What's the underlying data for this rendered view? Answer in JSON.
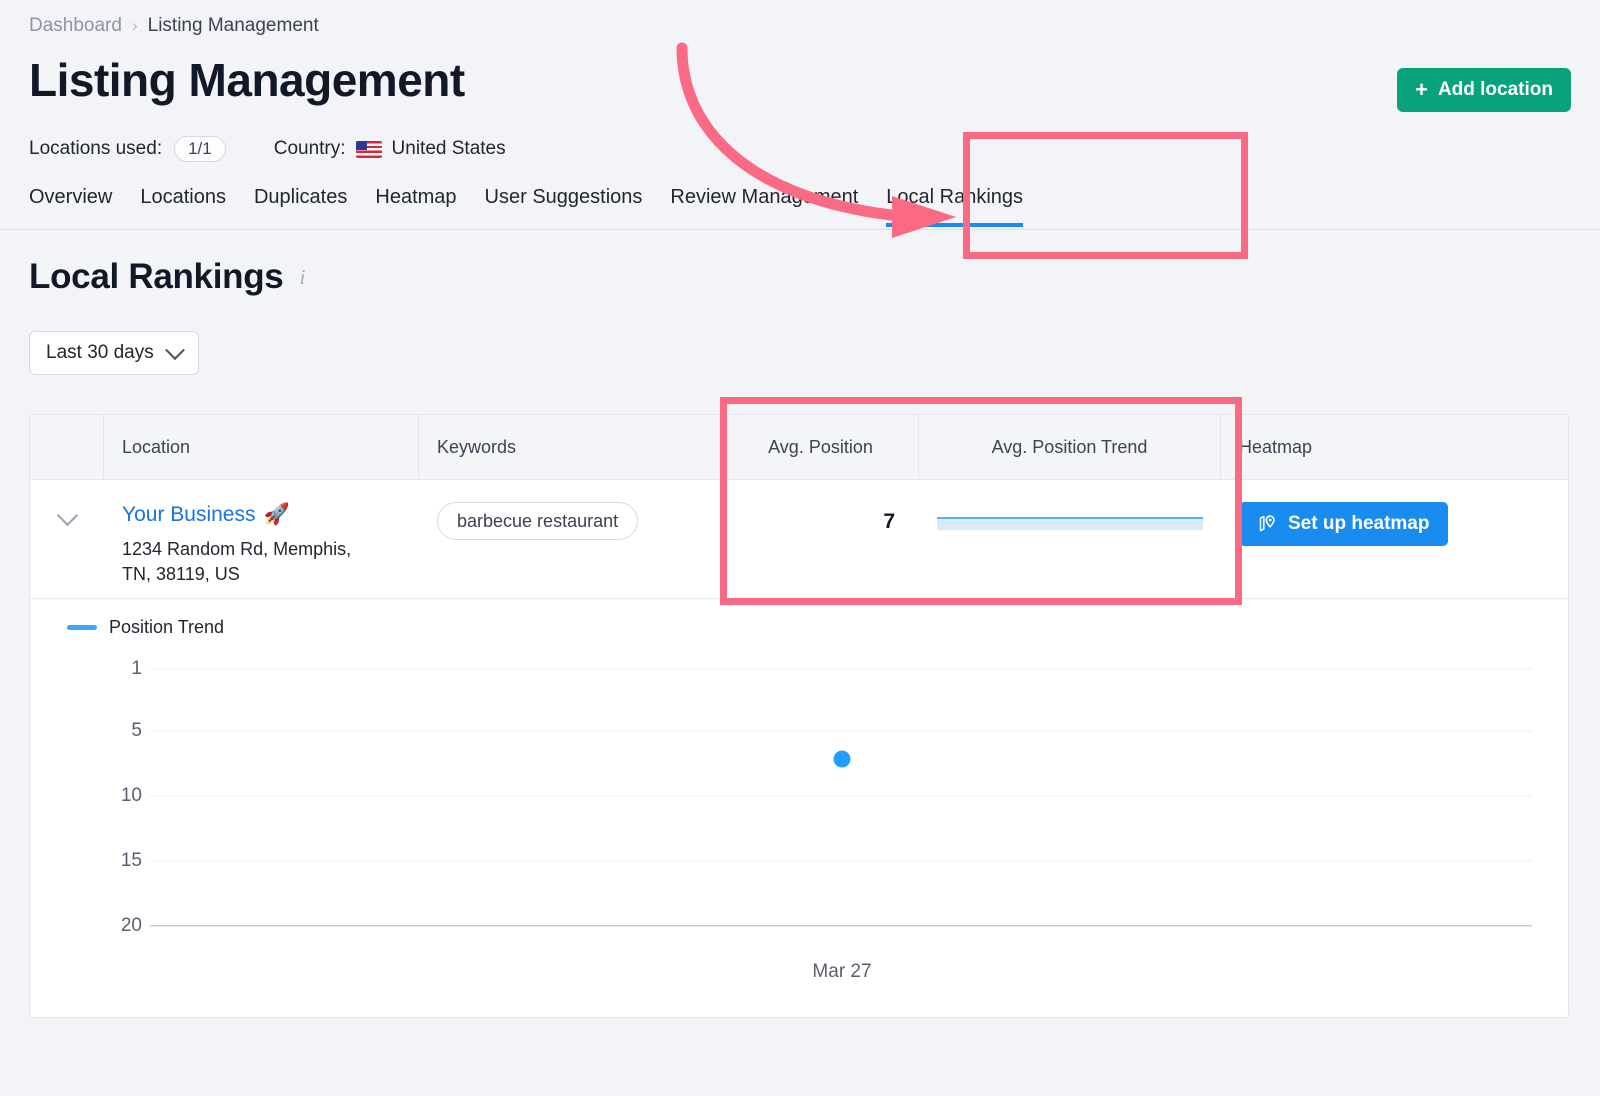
{
  "breadcrumb": {
    "root": "Dashboard",
    "separator": "›",
    "current": "Listing Management"
  },
  "header": {
    "title": "Listing Management",
    "add_location_label": "Add location",
    "add_location_plus": "+",
    "locations_used_label": "Locations used:",
    "locations_used_value": "1/1",
    "country_label": "Country:",
    "country_value": "United States"
  },
  "tabs": [
    {
      "label": "Overview",
      "active": false
    },
    {
      "label": "Locations",
      "active": false
    },
    {
      "label": "Duplicates",
      "active": false
    },
    {
      "label": "Heatmap",
      "active": false
    },
    {
      "label": "User Suggestions",
      "active": false
    },
    {
      "label": "Review Management",
      "active": false
    },
    {
      "label": "Local Rankings",
      "active": true
    }
  ],
  "section": {
    "title": "Local Rankings",
    "info_icon": "i",
    "date_filter_value": "Last 30 days"
  },
  "table": {
    "columns": [
      "",
      "Location",
      "Keywords",
      "Avg. Position",
      "Avg. Position Trend",
      "Heatmap"
    ],
    "row": {
      "business_name": "Your Business",
      "business_emoji": "🚀",
      "address": "1234 Random Rd, Memphis, TN, 38119, US",
      "keyword": "barbecue restaurant",
      "avg_position": "7",
      "heatmap_button_label": "Set up heatmap"
    }
  },
  "chart_data": {
    "type": "scatter",
    "title": "",
    "legend": [
      {
        "name": "Position Trend",
        "color": "#3ba7f7"
      }
    ],
    "legend_position": "top-left",
    "x": [
      "Mar 27"
    ],
    "values": [
      7
    ],
    "xlabel": "",
    "ylabel": "",
    "ytick_labels": [
      "1",
      "5",
      "10",
      "15",
      "20"
    ],
    "ytick_values": [
      1,
      5,
      10,
      15,
      20
    ],
    "ylim": [
      1,
      20
    ],
    "y_inverted": true,
    "grid": true,
    "series": [
      {
        "name": "Position Trend",
        "values": [
          7
        ]
      }
    ]
  },
  "annotations": {
    "accent_color": "#fa6a85",
    "boxes": [
      "local-rankings-tab",
      "avg-position-columns"
    ],
    "arrow": "curved-arrow-to-local-rankings-tab"
  },
  "colors": {
    "primary_blue": "#1a8cf0",
    "link_blue": "#1a73e8",
    "green": "#08a37d",
    "annotation_pink": "#fa6a85",
    "page_bg": "#f3f4f7"
  }
}
